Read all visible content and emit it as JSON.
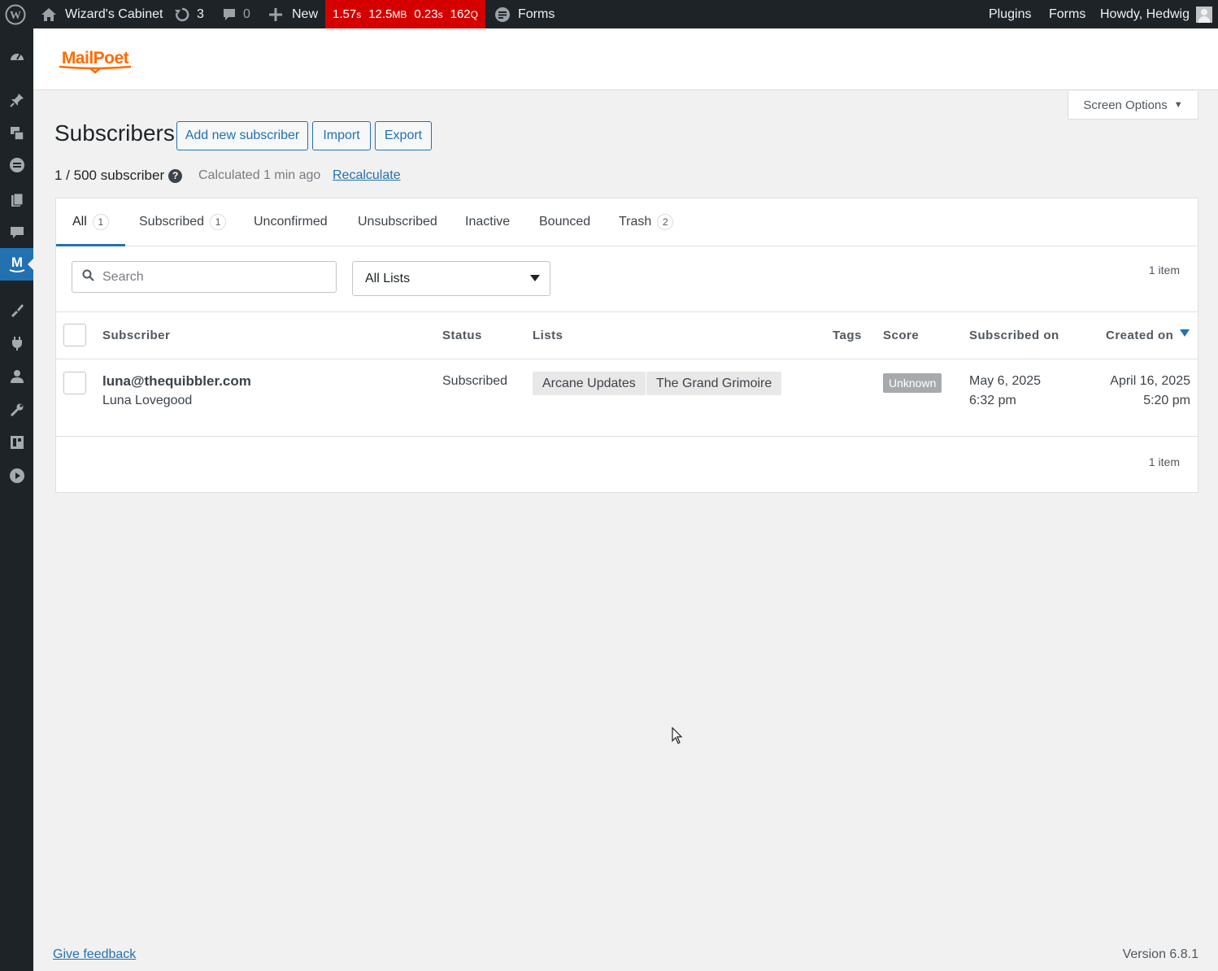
{
  "adminbar": {
    "site_name": "Wizard's Cabinet",
    "updates_count": "3",
    "comments_count": "0",
    "new_label": "New",
    "perf": {
      "time": "1.57",
      "time_unit": "s",
      "memory": "12.5",
      "memory_unit": "MB",
      "query_time": "0.23",
      "query_time_unit": "s",
      "queries": "162",
      "queries_unit": "Q"
    },
    "forms_label": "Forms",
    "right": {
      "plugins": "Plugins",
      "forms": "Forms",
      "howdy": "Howdy, Hedwig"
    }
  },
  "sidebar": {
    "icons": [
      "dashboard-icon",
      "pin-icon",
      "media-icon",
      "forms-icon",
      "pages-icon",
      "comments-icon",
      "mailpoet-icon",
      "appearance-icon",
      "plugins-icon",
      "users-icon",
      "tools-icon",
      "settings-icon",
      "play-icon"
    ],
    "active": "mailpoet-icon"
  },
  "header": {
    "logo_text": "MailPoet",
    "brand_color": "#ff6b00"
  },
  "screen_options": "Screen Options",
  "page": {
    "title": "Subscribers",
    "buttons": {
      "add": "Add new subscriber",
      "import": "Import",
      "export": "Export"
    },
    "subscriber_count": "1 / 500 subscriber",
    "help": "?",
    "calculated": "Calculated 1 min ago",
    "recalculate": "Recalculate"
  },
  "tabs": [
    {
      "label": "All",
      "count": "1",
      "active": true
    },
    {
      "label": "Subscribed",
      "count": "1"
    },
    {
      "label": "Unconfirmed"
    },
    {
      "label": "Unsubscribed"
    },
    {
      "label": "Inactive"
    },
    {
      "label": "Bounced"
    },
    {
      "label": "Trash",
      "count": "2"
    }
  ],
  "filters": {
    "search_placeholder": "Search",
    "list_selected": "All Lists",
    "items_top": "1 item",
    "items_bottom": "1 item"
  },
  "table": {
    "columns": {
      "subscriber": "Subscriber",
      "status": "Status",
      "lists": "Lists",
      "tags": "Tags",
      "score": "Score",
      "subscribed_on": "Subscribed on",
      "created_on": "Created on"
    },
    "rows": [
      {
        "email": "luna@thequibbler.com",
        "name": "Luna Lovegood",
        "status": "Subscribed",
        "lists": [
          "Arcane Updates",
          "The Grand Grimoire"
        ],
        "score": "Unknown",
        "subscribed_date": "May 6, 2025",
        "subscribed_time": "6:32 pm",
        "created_date": "April 16, 2025",
        "created_time": "5:20 pm"
      }
    ]
  },
  "footer": {
    "feedback": "Give feedback",
    "version": "Version 6.8.1"
  }
}
